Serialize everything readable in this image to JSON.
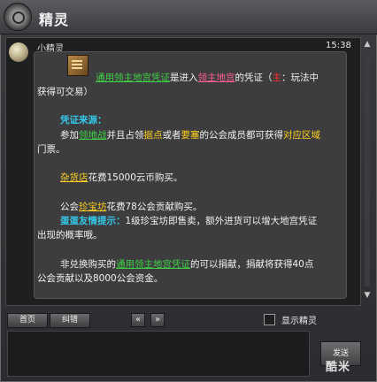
{
  "window": {
    "title": "精灵"
  },
  "message": {
    "sender": "小精灵",
    "time": "15:38",
    "line1": {
      "a": "通用领主地宫凭证",
      "b": "是进入",
      "c": "领主地宫",
      "d": "的凭证（",
      "e": "主",
      "f": "：玩法中"
    },
    "line2": "获得可交易）",
    "source_label": "凭证来源：",
    "line4": {
      "a": "参加",
      "b": "领地战",
      "c": "并且占领",
      "d": "据点",
      "e": "或者",
      "f": "要塞",
      "g": "的公会成员都可获得",
      "h": "对应区域"
    },
    "line5": "门票。",
    "line6": {
      "a": "杂货店",
      "b": "花费15000云币购买。"
    },
    "line7": {
      "a": "公会",
      "b": "珍宝坊",
      "c": "花费78公会贡献购买。"
    },
    "line8": {
      "a": "蛋蛋友情提示：",
      "b": "1级珍宝坊即售卖，额外进货可以增大地宫凭证"
    },
    "line9": "出现的概率哦。",
    "line10": {
      "a": "非兑换购买的",
      "b": "通用领主地宫凭证",
      "c": "的可以捐献，捐献将获得40点"
    },
    "line11": "公会贡献以及8000公会资金。"
  },
  "toolbar": {
    "home_label": "首页",
    "correct_label": "纠错",
    "prev_label": "«",
    "next_label": "»",
    "show_elf_label": "显示精灵",
    "send_label": "发送"
  },
  "watermark": "酷米"
}
